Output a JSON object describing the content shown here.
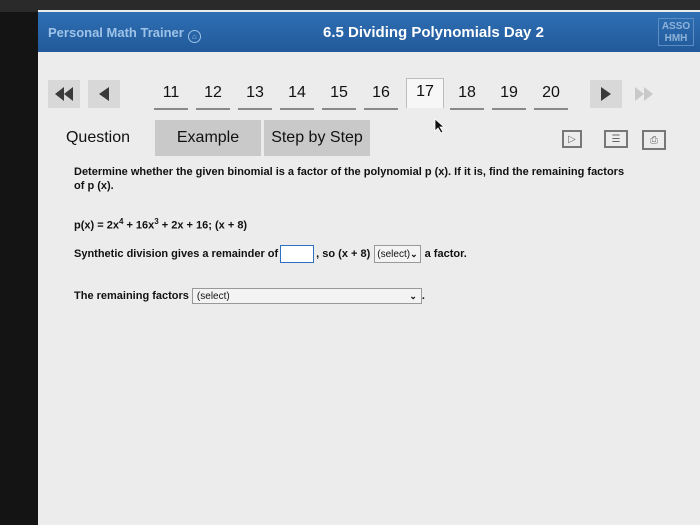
{
  "header": {
    "brand": "Personal Math Trainer",
    "title": "6.5 Dividing Polynomials Day 2",
    "logo": [
      "ASSO",
      "HMH"
    ]
  },
  "pagination": {
    "pages": [
      "11",
      "12",
      "13",
      "14",
      "15",
      "16",
      "17",
      "18",
      "19",
      "20"
    ],
    "active": "17"
  },
  "tabs": {
    "question": "Question",
    "example": "Example",
    "step_by_step": "Step by Step"
  },
  "problem": {
    "prompt": "Determine whether the given binomial is a factor of the polynomial p (x). If it is, find the remaining factors of p (x).",
    "poly_prefix": "p(x) = 2x",
    "poly_exp1": "4",
    "poly_mid": " + 16x",
    "poly_exp2": "3",
    "poly_suffix": " + 2x + 16; (x + 8)",
    "synthetic_prefix": "Synthetic division gives a remainder of",
    "synthetic_mid": ", so (x + 8)",
    "factor_select": "(select)",
    "synthetic_suffix": "a factor.",
    "remaining_label": "The remaining factors",
    "remaining_select": "(select)",
    "remaining_period": "."
  },
  "icons": {
    "first": "double-left-arrow",
    "prev": "left-arrow",
    "next": "right-arrow",
    "last": "double-right-arrow",
    "play": "play-icon",
    "book": "book-icon",
    "print": "print-icon"
  }
}
